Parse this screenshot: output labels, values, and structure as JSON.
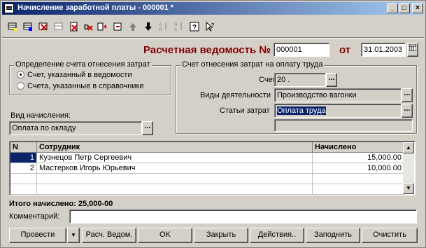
{
  "window": {
    "title": "Начисление заработной платы - 000001 *",
    "controls": [
      "_",
      "□",
      "×"
    ]
  },
  "toolbar": {
    "icons": [
      "new-row-icon",
      "copy-row-icon",
      "delete-row-icon",
      "edit-row-icon",
      "mark-delete-icon",
      "delete-icon",
      "insert-icon",
      "group-icon",
      "move-up-icon",
      "move-down-icon",
      "sort-asc-icon",
      "sort-desc-icon",
      "help-icon",
      "what-is-icon"
    ]
  },
  "header": {
    "doc_label": "Расчетная ведомость №",
    "doc_number": "000001",
    "from_label": "от",
    "date": "31.01.2003"
  },
  "account_group": {
    "legend": "Определение счета отнесения затрат",
    "options": [
      {
        "label": "Счет, указанный в ведомости",
        "selected": true
      },
      {
        "label": "Счета, указанные в справочнике",
        "selected": false
      }
    ]
  },
  "accrual": {
    "label": "Вид начисления:",
    "value": "Оплата по окладу"
  },
  "cost_group": {
    "legend": "Счет отнесения затрат на оплату труда",
    "account_label": "Счет",
    "account_value": "20 .",
    "activity_label": "Виды деятельности",
    "activity_value": "Производство вагонки",
    "cost_label": "Статьи затрат",
    "cost_value": "Оплата труда",
    "extra_value": ""
  },
  "table": {
    "columns": [
      "N",
      "Сотрудник",
      "Начислено"
    ],
    "rows": [
      {
        "n": "1",
        "employee": "Кузнецов Петр Сергеевич",
        "amount": "15,000.00"
      },
      {
        "n": "2",
        "employee": "Мастерков Игорь Юрьевич",
        "amount": "10,000.00"
      }
    ]
  },
  "total": {
    "label": "Итого начислено: 25,000-00"
  },
  "comment": {
    "label": "Комментарий:",
    "value": ""
  },
  "buttons": {
    "post": "Провести",
    "post_menu": "▼",
    "calc": "Расч. Ведом.",
    "ok": "OK",
    "close": "Закрыть",
    "actions": "Действия..",
    "fill": "Заподнить",
    "clear": "Очистить"
  }
}
